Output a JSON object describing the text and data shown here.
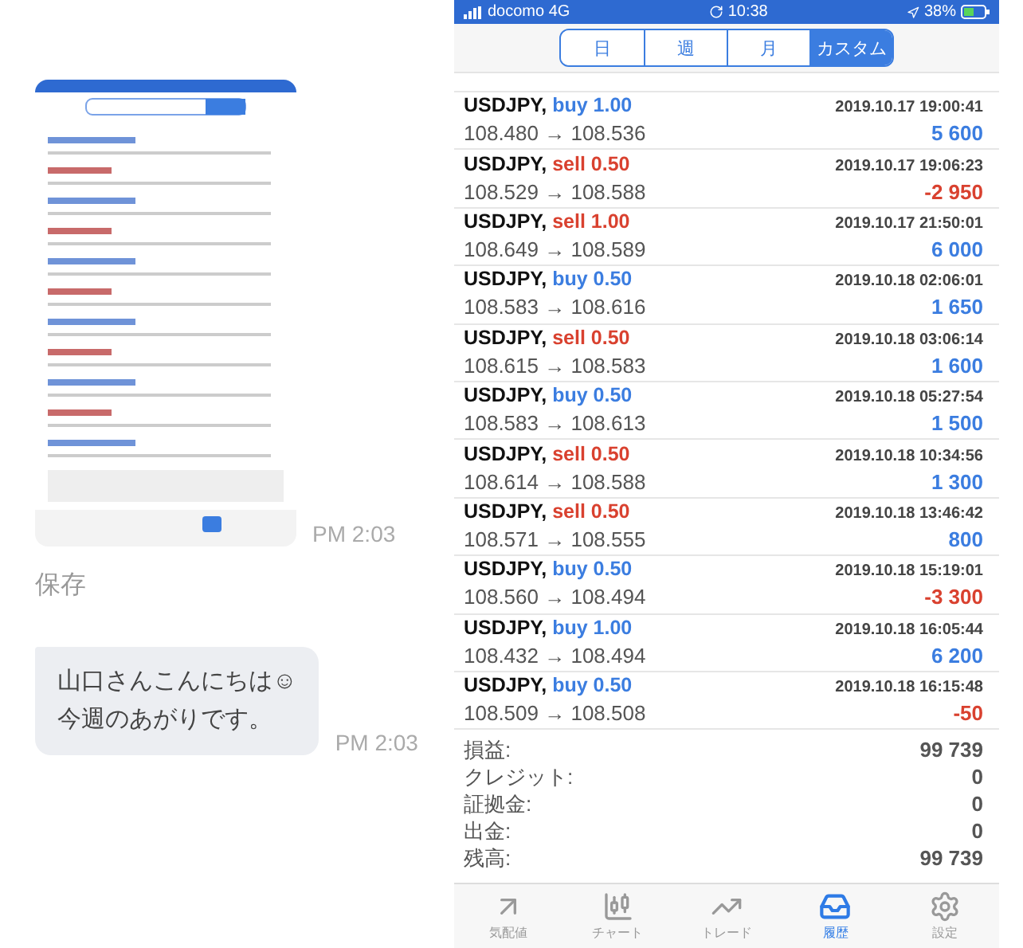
{
  "chat": {
    "image_time": "PM 2:03",
    "save_label": "保存",
    "message": {
      "lines": [
        "山口さんこんにちは☺",
        "今週のあがりです。"
      ],
      "time": "PM 2:03"
    }
  },
  "phone": {
    "status_bar": {
      "carrier": "docomo 4G",
      "time": "10:38",
      "battery": "38%"
    },
    "period_tabs": [
      {
        "label": "日",
        "selected": false
      },
      {
        "label": "週",
        "selected": false
      },
      {
        "label": "月",
        "selected": false
      },
      {
        "label": "カスタム",
        "selected": true
      }
    ],
    "trades": [
      {
        "symbol": "USDJPY,",
        "kind": "buy",
        "order": "buy 1.00",
        "time": "2019.10.17 19:00:41",
        "prices": "108.480 → 108.536",
        "profit": "5 600",
        "loss": false
      },
      {
        "symbol": "USDJPY,",
        "kind": "sell",
        "order": "sell 0.50",
        "time": "2019.10.17 19:06:23",
        "prices": "108.529 → 108.588",
        "profit": "-2 950",
        "loss": true
      },
      {
        "symbol": "USDJPY,",
        "kind": "sell",
        "order": "sell 1.00",
        "time": "2019.10.17 21:50:01",
        "prices": "108.649 → 108.589",
        "profit": "6 000",
        "loss": false
      },
      {
        "symbol": "USDJPY,",
        "kind": "buy",
        "order": "buy 0.50",
        "time": "2019.10.18 02:06:01",
        "prices": "108.583 → 108.616",
        "profit": "1 650",
        "loss": false
      },
      {
        "symbol": "USDJPY,",
        "kind": "sell",
        "order": "sell 0.50",
        "time": "2019.10.18 03:06:14",
        "prices": "108.615 → 108.583",
        "profit": "1 600",
        "loss": false
      },
      {
        "symbol": "USDJPY,",
        "kind": "buy",
        "order": "buy 0.50",
        "time": "2019.10.18 05:27:54",
        "prices": "108.583 → 108.613",
        "profit": "1 500",
        "loss": false
      },
      {
        "symbol": "USDJPY,",
        "kind": "sell",
        "order": "sell 0.50",
        "time": "2019.10.18 10:34:56",
        "prices": "108.614 → 108.588",
        "profit": "1 300",
        "loss": false
      },
      {
        "symbol": "USDJPY,",
        "kind": "sell",
        "order": "sell 0.50",
        "time": "2019.10.18 13:46:42",
        "prices": "108.571 → 108.555",
        "profit": "800",
        "loss": false
      },
      {
        "symbol": "USDJPY,",
        "kind": "buy",
        "order": "buy 0.50",
        "time": "2019.10.18 15:19:01",
        "prices": "108.560 → 108.494",
        "profit": "-3 300",
        "loss": true
      },
      {
        "symbol": "USDJPY,",
        "kind": "buy",
        "order": "buy 1.00",
        "time": "2019.10.18 16:05:44",
        "prices": "108.432 → 108.494",
        "profit": "6 200",
        "loss": false
      },
      {
        "symbol": "USDJPY,",
        "kind": "buy",
        "order": "buy 0.50",
        "time": "2019.10.18 16:15:48",
        "prices": "108.509 → 108.508",
        "profit": "-50",
        "loss": true
      }
    ],
    "summary": [
      {
        "label": "損益:",
        "value": "99 739"
      },
      {
        "label": "クレジット:",
        "value": "0"
      },
      {
        "label": "証拠金:",
        "value": "0"
      },
      {
        "label": "出金:",
        "value": "0"
      },
      {
        "label": "残高:",
        "value": "99 739"
      }
    ],
    "tab_bar": [
      {
        "kind": "quotes",
        "label": "気配値",
        "selected": false
      },
      {
        "kind": "chart",
        "label": "チャート",
        "selected": false
      },
      {
        "kind": "trade",
        "label": "トレード",
        "selected": false
      },
      {
        "kind": "history",
        "label": "履歴",
        "selected": true
      },
      {
        "kind": "settings",
        "label": "設定",
        "selected": false
      }
    ]
  }
}
